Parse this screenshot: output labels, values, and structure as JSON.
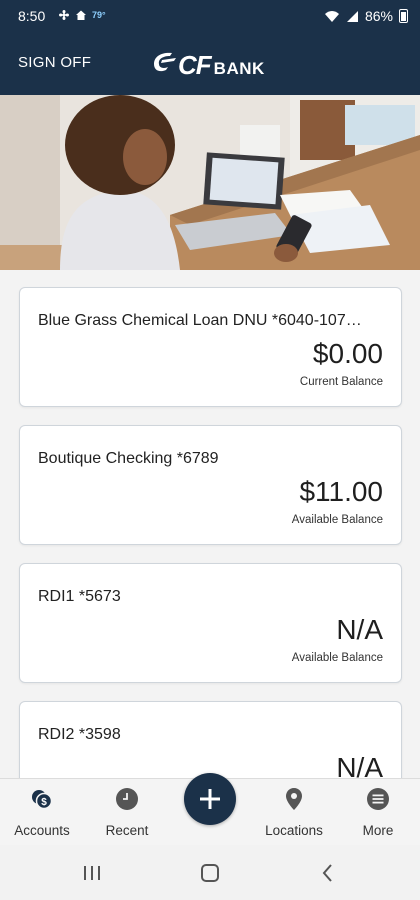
{
  "status_bar": {
    "time": "8:50",
    "temperature": "79°",
    "battery": "86%"
  },
  "app_bar": {
    "sign_off": "SIGN OFF",
    "logo_cf": "CF",
    "logo_bank": "BANK"
  },
  "accounts": [
    {
      "name": "Blue Grass Chemical Loan DNU *6040-107…",
      "amount": "$0.00",
      "label": "Current Balance"
    },
    {
      "name": "Boutique Checking *6789",
      "amount": "$11.00",
      "label": "Available Balance"
    },
    {
      "name": "RDI1 *5673",
      "amount": "N/A",
      "label": "Available Balance"
    },
    {
      "name": "RDI2 *3598",
      "amount": "N/A",
      "label": ""
    }
  ],
  "bottom_nav": {
    "accounts": "Accounts",
    "recent": "Recent",
    "locations": "Locations",
    "more": "More"
  },
  "colors": {
    "brand_navy": "#1b3149",
    "card_border": "#cfd5db"
  }
}
